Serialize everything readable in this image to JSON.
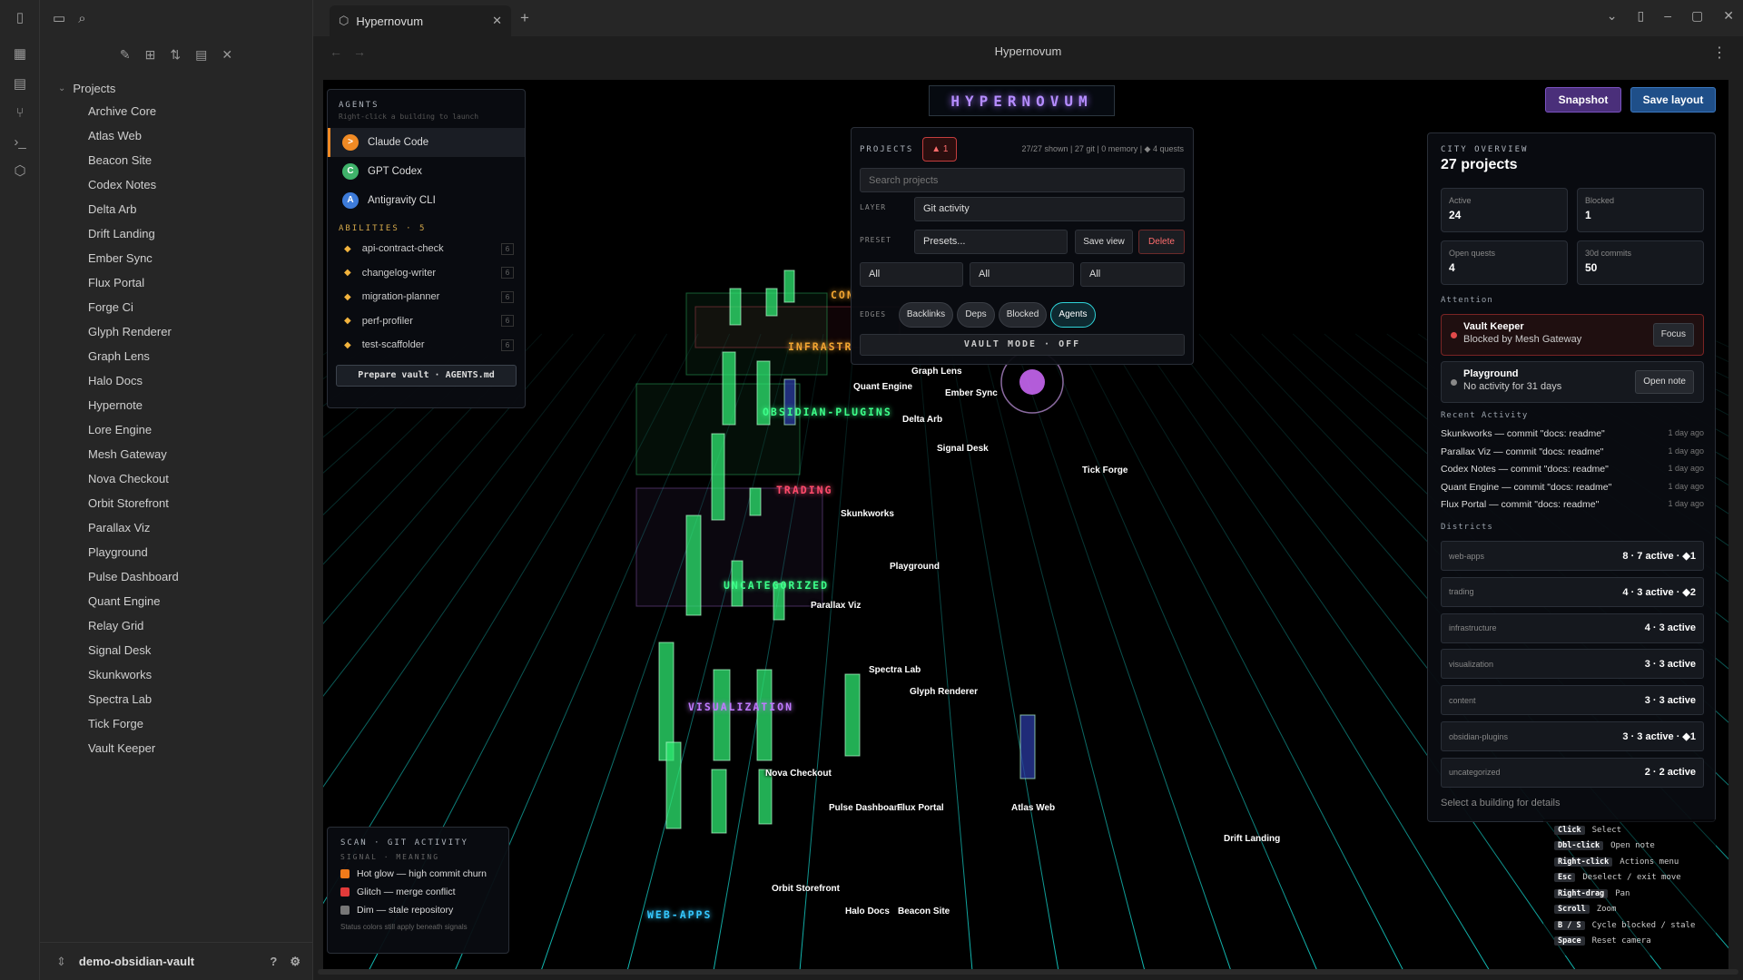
{
  "app": {
    "tab_title": "Hypernovum",
    "view_title": "Hypernovum",
    "hud_title": "HYPERNOVUM",
    "vault_name": "demo-obsidian-vault"
  },
  "sidebar": {
    "root": "Projects",
    "items": [
      "Archive Core",
      "Atlas Web",
      "Beacon Site",
      "Codex Notes",
      "Delta Arb",
      "Drift Landing",
      "Ember Sync",
      "Flux Portal",
      "Forge Ci",
      "Glyph Renderer",
      "Graph Lens",
      "Halo Docs",
      "Hypernote",
      "Lore Engine",
      "Mesh Gateway",
      "Nova Checkout",
      "Orbit Storefront",
      "Parallax Viz",
      "Playground",
      "Pulse Dashboard",
      "Quant Engine",
      "Relay Grid",
      "Signal Desk",
      "Skunkworks",
      "Spectra Lab",
      "Tick Forge",
      "Vault Keeper"
    ]
  },
  "toolbar": {
    "snapshot": "Snapshot",
    "save_layout": "Save layout"
  },
  "agents": {
    "title": "AGENTS",
    "subtitle": "Right-click a building to launch",
    "list": [
      {
        "name": "Claude Code",
        "icon": ">",
        "color": "#f08a24"
      },
      {
        "name": "GPT Codex",
        "icon": "C",
        "color": "#3fb26a"
      },
      {
        "name": "Antigravity CLI",
        "icon": "A",
        "color": "#3d7bd9"
      }
    ],
    "abilities_title": "ABILITIES · 5",
    "abilities": [
      {
        "name": "api-contract-check",
        "count": "6"
      },
      {
        "name": "changelog-writer",
        "count": "6"
      },
      {
        "name": "migration-planner",
        "count": "6"
      },
      {
        "name": "perf-profiler",
        "count": "6"
      },
      {
        "name": "test-scaffolder",
        "count": "6"
      }
    ],
    "prepare": "Prepare vault · AGENTS.md"
  },
  "projects_panel": {
    "title": "PROJECTS",
    "warn": "1",
    "stats": "27/27 shown | 27 git | 0 memory | ◆ 4 quests",
    "search_placeholder": "Search projects",
    "layer_label": "LAYER",
    "layer_value": "Git activity",
    "preset_label": "PRESET",
    "preset_value": "Presets...",
    "save_view": "Save view",
    "delete": "Delete",
    "filters": [
      "All",
      "All",
      "All"
    ],
    "edges_label": "EDGES",
    "edges": [
      "Backlinks",
      "Deps",
      "Blocked",
      "Agents"
    ],
    "vault_mode": "VAULT MODE · OFF"
  },
  "overview": {
    "kicker": "CITY OVERVIEW",
    "headline": "27 projects",
    "stats": [
      {
        "label": "Active",
        "value": "24"
      },
      {
        "label": "Blocked",
        "value": "1"
      },
      {
        "label": "Open quests",
        "value": "4"
      },
      {
        "label": "30d commits",
        "value": "50"
      }
    ],
    "attention_title": "Attention",
    "attention": [
      {
        "title": "Vault Keeper",
        "sub": "Blocked by Mesh Gateway",
        "action": "Focus",
        "color": "#e24a4a"
      },
      {
        "title": "Playground",
        "sub": "No activity for 31 days",
        "action": "Open note",
        "color": "#888888"
      }
    ],
    "recent_title": "Recent Activity",
    "recent": [
      {
        "text": "Skunkworks — commit \"docs: readme\"",
        "when": "1 day ago"
      },
      {
        "text": "Parallax Viz — commit \"docs: readme\"",
        "when": "1 day ago"
      },
      {
        "text": "Codex Notes — commit \"docs: readme\"",
        "when": "1 day ago"
      },
      {
        "text": "Quant Engine — commit \"docs: readme\"",
        "when": "1 day ago"
      },
      {
        "text": "Flux Portal — commit \"docs: readme\"",
        "when": "1 day ago"
      }
    ],
    "districts_title": "Districts",
    "districts": [
      {
        "name": "web-apps",
        "value": "8 · 7 active · ◆1"
      },
      {
        "name": "trading",
        "value": "4 · 3 active · ◆2"
      },
      {
        "name": "infrastructure",
        "value": "4 · 3 active"
      },
      {
        "name": "visualization",
        "value": "3 · 3 active"
      },
      {
        "name": "content",
        "value": "3 · 3 active"
      },
      {
        "name": "obsidian-plugins",
        "value": "3 · 3 active · ◆1"
      },
      {
        "name": "uncategorized",
        "value": "2 · 2 active"
      }
    ],
    "footer": "Select a building for details"
  },
  "scan": {
    "title": "SCAN · GIT ACTIVITY",
    "subtitle": "SIGNAL · MEANING",
    "rows": [
      {
        "label": "Hot glow — high commit churn",
        "color": "#f07a1a"
      },
      {
        "label": "Glitch — merge conflict",
        "color": "#e23a3a"
      },
      {
        "label": "Dim — stale repository",
        "color": "#777777"
      }
    ],
    "note": "Status colors still apply beneath signals"
  },
  "keys": [
    {
      "k": "Click",
      "d": "Select"
    },
    {
      "k": "Dbl-click",
      "d": "Open note"
    },
    {
      "k": "Right-click",
      "d": "Actions menu"
    },
    {
      "k": "Esc",
      "d": "Deselect / exit move"
    },
    {
      "k": "Right-drag",
      "d": "Pan"
    },
    {
      "k": "Scroll",
      "d": "Zoom"
    },
    {
      "k": "B / S",
      "d": "Cycle blocked / stale"
    },
    {
      "k": "Space",
      "d": "Reset camera"
    }
  ],
  "districts3d": [
    {
      "name": "CON",
      "color": "#f2a531"
    },
    {
      "name": "INFRASTR",
      "color": "#f2a531"
    },
    {
      "name": "OBSIDIAN-PLUGINS",
      "color": "#3dff8a"
    },
    {
      "name": "TRADING",
      "color": "#ff4a6a"
    },
    {
      "name": "UNCATEGORIZED",
      "color": "#3dff8a"
    },
    {
      "name": "VISUALIZATION",
      "color": "#c07aff"
    },
    {
      "name": "WEB-APPS",
      "color": "#35c8ff"
    }
  ],
  "buildings": [
    "Graph Lens",
    "Quant Engine",
    "Ember Sync",
    "Delta Arb",
    "Signal Desk",
    "Tick Forge",
    "Skunkworks",
    "Playground",
    "Parallax Viz",
    "Spectra Lab",
    "Glyph Renderer",
    "Nova Checkout",
    "Pulse Dashboard",
    "Flux Portal",
    "Atlas Web",
    "Drift Landing",
    "Orbit Storefront",
    "Halo Docs",
    "Beacon Site"
  ]
}
